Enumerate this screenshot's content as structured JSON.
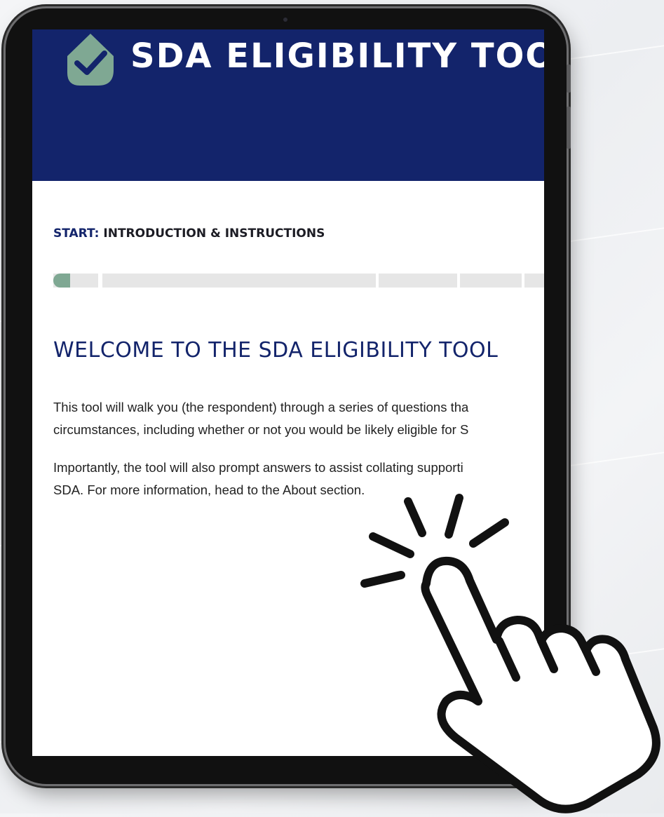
{
  "header": {
    "app_title": "SDA ELIGIBILITY TOOL",
    "logo_icon": "house-check-icon",
    "background_color": "#13246b",
    "logo_color": "#7fa893"
  },
  "step": {
    "prefix": "START:",
    "title": "INTRODUCTION & INSTRUCTIONS"
  },
  "progress": {
    "current_step": 1,
    "fill_color": "#7fa893"
  },
  "content": {
    "heading": "WELCOME TO THE SDA ELIGIBILITY TOOL",
    "paragraph_1_line_1": "This tool will walk you (the respondent) through a series of questions tha",
    "paragraph_1_line_2": "circumstances, including whether or not you would be likely eligible for S",
    "paragraph_2_line_1": "Importantly, the tool will also prompt answers to assist collating supporti",
    "paragraph_2_line_2": "SDA. For more information, head to the About section."
  },
  "overlay": {
    "icon": "pointing-hand-tap-icon"
  }
}
